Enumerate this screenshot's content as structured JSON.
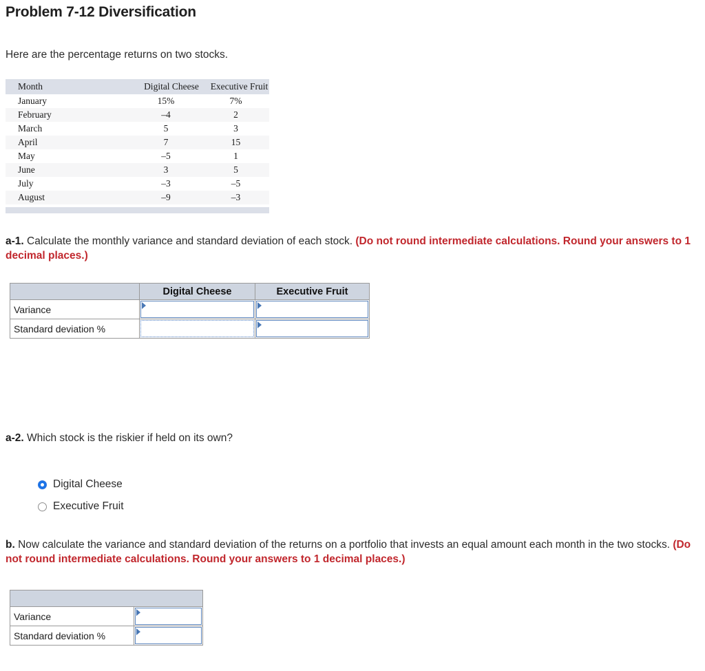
{
  "page": {
    "title": "Problem 7-12 Diversification",
    "intro": "Here are the percentage returns on two stocks."
  },
  "returns_table": {
    "headers": [
      "Month",
      "Digital Cheese",
      "Executive Fruit"
    ],
    "rows": [
      {
        "month": "January",
        "digital_cheese": "15%",
        "executive_fruit": "7%"
      },
      {
        "month": "February",
        "digital_cheese": "–4",
        "executive_fruit": "2"
      },
      {
        "month": "March",
        "digital_cheese": "5",
        "executive_fruit": "3"
      },
      {
        "month": "April",
        "digital_cheese": "7",
        "executive_fruit": "15"
      },
      {
        "month": "May",
        "digital_cheese": "–5",
        "executive_fruit": "1"
      },
      {
        "month": "June",
        "digital_cheese": "3",
        "executive_fruit": "5"
      },
      {
        "month": "July",
        "digital_cheese": "–3",
        "executive_fruit": "–5"
      },
      {
        "month": "August",
        "digital_cheese": "–9",
        "executive_fruit": "–3"
      }
    ]
  },
  "question_a1": {
    "label": "a-1.",
    "text": " Calculate the monthly variance and standard deviation of each stock. ",
    "instruction": "(Do not round intermediate calculations. Round your answers to 1 decimal places.)",
    "table": {
      "corner_header": "",
      "column_headers": [
        "Digital Cheese",
        "Executive Fruit"
      ],
      "row_labels": [
        "Variance",
        "Standard deviation %"
      ],
      "values": [
        {
          "digital_cheese": "",
          "executive_fruit": ""
        },
        {
          "digital_cheese": "",
          "executive_fruit": ""
        }
      ]
    }
  },
  "question_a2": {
    "label": "a-2.",
    "text": " Which stock is the riskier if held on its own?",
    "options": [
      {
        "label": "Digital Cheese",
        "selected": true
      },
      {
        "label": "Executive Fruit",
        "selected": false
      }
    ]
  },
  "question_b": {
    "label": "b.",
    "text": " Now calculate the variance and standard deviation of the  returns on a portfolio that invests an equal amount each month in the two stocks. ",
    "instruction": "(Do not round intermediate calculations. Round your answers to 1 decimal places.)",
    "table": {
      "blank_header": "",
      "row_labels": [
        "Variance",
        "Standard deviation %"
      ],
      "values": [
        {
          "value": ""
        },
        {
          "value": ""
        }
      ]
    }
  },
  "colors": {
    "table_header_bg": "#ced5e0",
    "book_header_bg": "#dbdfe8",
    "input_border": "#5c85bd",
    "marker": "#4a78b5",
    "instruction_red": "#c1272d",
    "radio_selected": "#1a73e8"
  }
}
